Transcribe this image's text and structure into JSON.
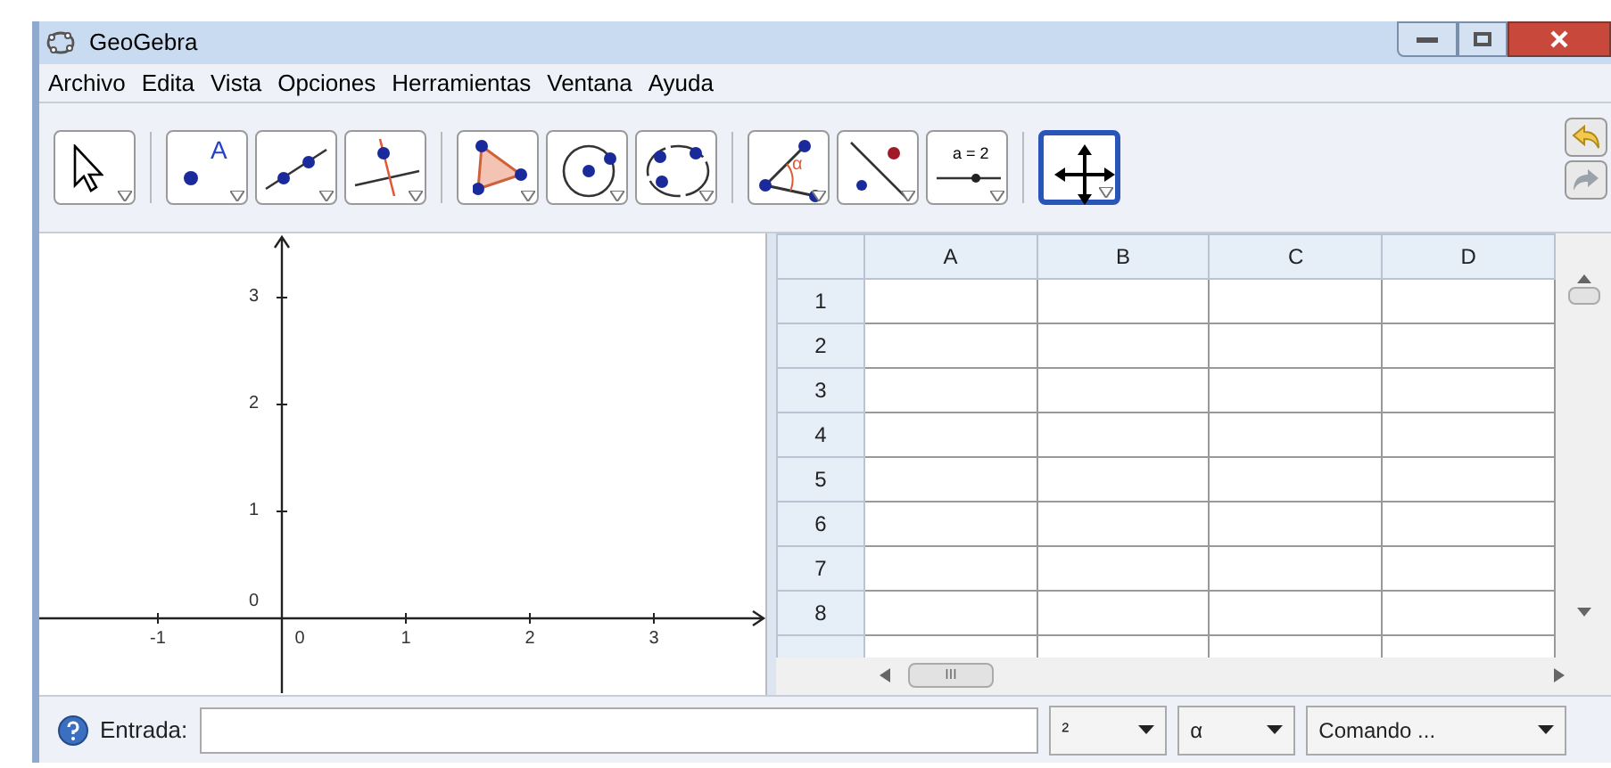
{
  "window": {
    "title": "GeoGebra"
  },
  "menu": [
    "Archivo",
    "Edita",
    "Vista",
    "Opciones",
    "Herramientas",
    "Ventana",
    "Ayuda"
  ],
  "tools": [
    {
      "kind": "select",
      "selected": false
    },
    {
      "kind": "point",
      "label": "A",
      "selected": false
    },
    {
      "kind": "line",
      "selected": false
    },
    {
      "kind": "perpendicular",
      "selected": false
    },
    {
      "kind": "polygon",
      "selected": false
    },
    {
      "kind": "circle",
      "selected": false
    },
    {
      "kind": "conic",
      "selected": false
    },
    {
      "kind": "angle",
      "label": "α",
      "selected": false
    },
    {
      "kind": "reflect",
      "selected": false
    },
    {
      "kind": "slider",
      "label": "a = 2",
      "selected": false
    },
    {
      "kind": "move",
      "selected": true
    }
  ],
  "graphics": {
    "x_ticks": [
      "-1",
      "0",
      "1",
      "2",
      "3"
    ],
    "y_ticks": [
      "3",
      "2",
      "1",
      "0"
    ]
  },
  "spreadsheet": {
    "columns": [
      "A",
      "B",
      "C",
      "D"
    ],
    "rows": [
      "1",
      "2",
      "3",
      "4",
      "5",
      "6",
      "7",
      "8"
    ],
    "scrollbar_label": "III"
  },
  "input_bar": {
    "label": "Entrada:",
    "dropdowns": [
      "²",
      "α",
      "Comando ..."
    ]
  }
}
